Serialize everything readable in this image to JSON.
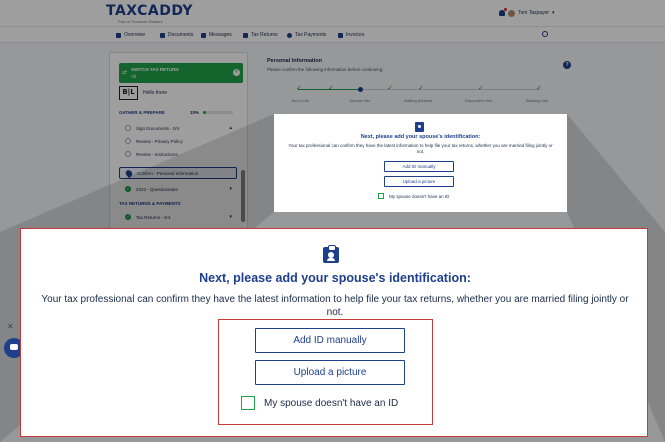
{
  "header": {
    "logo": "TAXCADDY",
    "logo_sub": "Part of Thomson Reuters",
    "user_name": "Tom Taxpayer",
    "user_caret": "▾"
  },
  "nav": {
    "items": [
      {
        "label": "Overview",
        "icon": "home-icon"
      },
      {
        "label": "Documents",
        "icon": "folder-icon"
      },
      {
        "label": "Messages",
        "icon": "message-icon"
      },
      {
        "label": "Tax Returns",
        "icon": "tax-return-icon"
      },
      {
        "label": "Tax Payments",
        "icon": "dollar-icon"
      },
      {
        "label": "Invoices",
        "icon": "invoice-icon"
      }
    ]
  },
  "sidebar": {
    "switch_label": "SWITCH TAX RETURN",
    "switch_year": "All",
    "firm_logo": "B|L",
    "hello": "Hello there",
    "gather_title": "GATHER & PREPARE",
    "progress_pct": "10%",
    "progress_fraction": 0.1,
    "items": [
      {
        "label": "Sign Documents - 0/4",
        "state": "todo",
        "chev": "▴"
      },
      {
        "label": "Review - Privacy Policy",
        "state": "todo",
        "chev": ""
      },
      {
        "label": "Review - Instructions",
        "state": "todo",
        "chev": ""
      },
      {
        "label": "Confirm - Personal Information",
        "state": "active",
        "chev": ""
      },
      {
        "label": "2022 - Questionnaire",
        "state": "done",
        "chev": "▾"
      }
    ],
    "returns_title": "TAX RETURNS & PAYMENTS",
    "returns_item": {
      "label": "Tax Returns - 4/4",
      "chev": "▾"
    }
  },
  "main": {
    "title": "Personal Information",
    "subtitle": "Please confirm the following information before continuing:",
    "steps": [
      "Tom's Info",
      "Spouse Info",
      "Mailing Address",
      "Dependent Info",
      "Banking Info"
    ]
  },
  "card": {
    "heading": "Next, please add your spouse's identification:",
    "description": "Your tax professional can confirm they have the latest information to help file your tax returns, whether you are married filing jointly or not.",
    "add_manual": "Add ID manually",
    "upload": "Upload a picture",
    "no_id": "My spouse doesn't have an ID"
  },
  "colors": {
    "brand": "#1d3f8c",
    "success": "#1fa34a",
    "highlight": "#c83a3a"
  }
}
